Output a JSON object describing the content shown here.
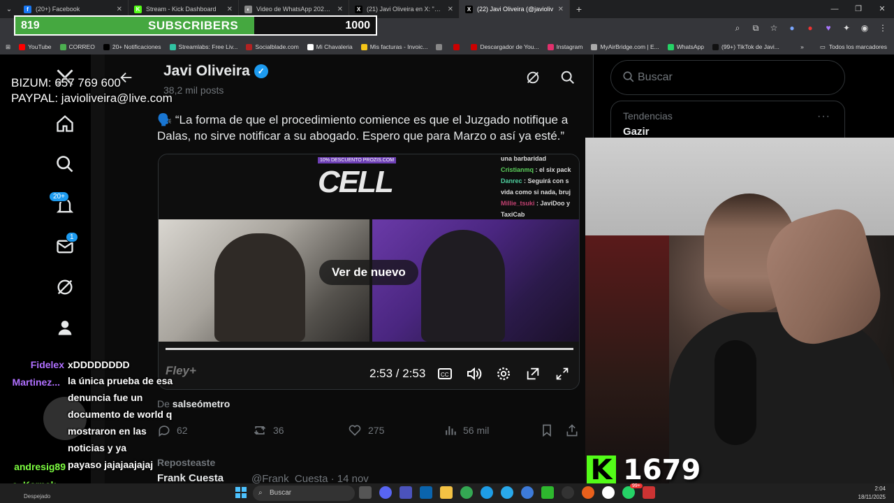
{
  "browser": {
    "tabs": [
      {
        "label": "(20+) Facebook",
        "color": "#1877f2",
        "glyph": "f",
        "active": false
      },
      {
        "label": "Stream - Kick Dashboard",
        "color": "#53fc18",
        "glyph": "K",
        "active": false
      },
      {
        "label": "Video de WhatsApp 2025-10-2",
        "color": "#888888",
        "glyph": "◐",
        "active": false
      },
      {
        "label": "(21) Javi Oliveira en X: \"URGENT",
        "color": "#000000",
        "glyph": "X",
        "active": false
      },
      {
        "label": "(22) Javi Oliveira (@javioliv",
        "color": "#000000",
        "glyph": "X",
        "active": true
      }
    ],
    "new_tab": "+",
    "bookmarks": [
      {
        "label": "YouTube",
        "color": "#ff0000"
      },
      {
        "label": "CORREO",
        "color": "#4caf50"
      },
      {
        "label": "20+ Notificaciones",
        "color": "#000000"
      },
      {
        "label": "Streamlabs: Free Liv...",
        "color": "#31c3a2"
      },
      {
        "label": "Socialblade.com",
        "color": "#b22222"
      },
      {
        "label": "Mi Chavaleria",
        "color": "#ffffff"
      },
      {
        "label": "Mis facturas - Invoic...",
        "color": "#f5c518"
      },
      {
        "label": "",
        "color": "#888888"
      },
      {
        "label": "",
        "color": "#cc0000"
      },
      {
        "label": "Descargador de You...",
        "color": "#cc0000"
      },
      {
        "label": "Instagram",
        "color": "#e1306c"
      },
      {
        "label": "MyAirBridge.com | E...",
        "color": "#aaaaaa"
      },
      {
        "label": "WhatsApp",
        "color": "#25d366"
      },
      {
        "label": "(99+) TikTok de Javi...",
        "color": "#111111"
      }
    ],
    "bookmarks_more": "»",
    "all_bookmarks": "Todos los marcadores"
  },
  "subscriber_goal": {
    "current": "819",
    "title": "SUBSCRIBERS",
    "goal": "1000",
    "progress": 0.819
  },
  "donations": {
    "bizum": "BIZUM: 657 769 600",
    "paypal": "PAYPAL: javioliveira@live.com"
  },
  "x": {
    "nav_badges": {
      "notifications": "20+",
      "messages": "1"
    },
    "profile": {
      "name": "Javi Oliveira",
      "posts": "38,2 mil posts"
    },
    "tweet_text": "🗣️ “La forma de que el procedimiento comience es que el Juzgado notifique a Dalas, no sirve notificar a su abogado. Espero que para Marzo o así ya esté.”",
    "video": {
      "promo": "10% DESCUENTO PROZIS.COM",
      "logo": "CELL",
      "overlay_chat": [
        {
          "user": "",
          "msg": "una barbaridad"
        },
        {
          "user": "Cristianmq",
          "msg": " : el six pack"
        },
        {
          "user": "Danrec",
          "msg": " : Seguirá con s vida como si nada, bruj"
        },
        {
          "user": "Millie_tsuki",
          "msg": " : JaviDoo y TaxiCab"
        }
      ],
      "replay_label": "Ver de nuevo",
      "time": "2:53 / 2:53",
      "brand": "Fley+"
    },
    "source": {
      "prefix": "De ",
      "name": "salseómetro"
    },
    "actions": {
      "replies": "62",
      "reposts": "36",
      "likes": "275",
      "views": "56 mil"
    },
    "repost_line": "Reposteaste",
    "next_author": "Frank Cuesta",
    "next_handle": "@Frank_Cuesta · 14 nov",
    "search_placeholder": "Buscar",
    "trends": {
      "category": "Tendencias",
      "name": "Gazir",
      "more": "···"
    }
  },
  "chat": [
    {
      "user": "Fidelex",
      "user_color": "#b070ff",
      "lines": [
        "xDDDDDDDD"
      ]
    },
    {
      "user": "Martinez...",
      "user_color": "#b070ff",
      "lines": [
        "la única prueba de esa",
        "denuncia fue un",
        "documento de world q",
        "mostraron en las",
        "noticias y ya",
        "payaso jajajaajajaj"
      ]
    },
    {
      "user": "andresig89",
      "user_color": "#7cfc40",
      "lines": []
    },
    {
      "user": "e_Karnak...",
      "user_color": "#7cfc40",
      "lines": []
    }
  ],
  "kick_viewers": {
    "logo": "K",
    "count": "1679"
  },
  "taskbar": {
    "weather": "Despejado",
    "search": "Buscar",
    "time": "2:04",
    "date": "18/11/2025",
    "badge": "99+"
  }
}
